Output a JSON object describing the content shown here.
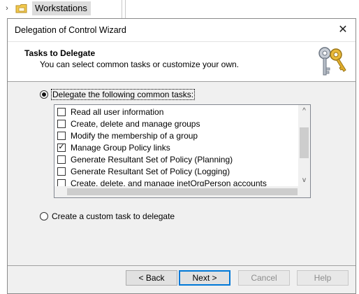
{
  "background_tree": {
    "expander": "›",
    "folder_icon": "folder-icon",
    "label": "Workstations"
  },
  "dialog": {
    "title": "Delegation of Control Wizard",
    "close_glyph": "✕",
    "header": {
      "title": "Tasks to Delegate",
      "subtitle": "You can select common tasks or customize your own.",
      "icon": "keys-icon"
    },
    "options": {
      "common_label": "Delegate the following common tasks:",
      "common_selected": true,
      "custom_label": "Create a custom task to delegate",
      "custom_selected": false
    },
    "tasks": [
      {
        "label": "Read all user information",
        "checked": false
      },
      {
        "label": "Create, delete and manage groups",
        "checked": false
      },
      {
        "label": "Modify the membership of a group",
        "checked": false
      },
      {
        "label": "Manage Group Policy links",
        "checked": true
      },
      {
        "label": "Generate Resultant Set of Policy (Planning)",
        "checked": false
      },
      {
        "label": "Generate Resultant Set of Policy (Logging)",
        "checked": false
      },
      {
        "label": "Create, delete, and manage inetOrgPerson accounts",
        "checked": false
      }
    ],
    "scroll_up": "^",
    "scroll_down": "v",
    "buttons": {
      "back": "< Back",
      "next": "Next >",
      "cancel": "Cancel",
      "help": "Help"
    }
  }
}
